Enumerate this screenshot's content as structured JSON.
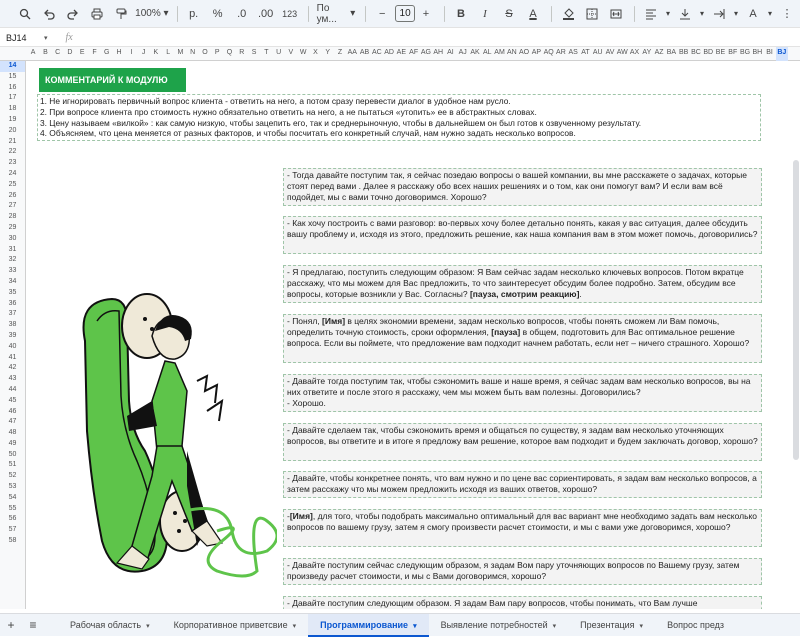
{
  "toolbar": {
    "zoom": "100%",
    "currency": "р.",
    "percent": "%",
    "dec_down": ".0",
    "dec_up": ".00",
    "number_format": "123",
    "font_name": "По ум...",
    "font_size": "10",
    "bold": "B",
    "italic": "I",
    "strike": "S",
    "text_color": "A"
  },
  "formula_bar": {
    "cell_ref": "BJ14",
    "fx": "fx"
  },
  "columns": [
    "A",
    "B",
    "C",
    "D",
    "E",
    "F",
    "G",
    "H",
    "I",
    "J",
    "K",
    "L",
    "M",
    "N",
    "O",
    "P",
    "Q",
    "R",
    "S",
    "T",
    "U",
    "V",
    "W",
    "X",
    "Y",
    "Z",
    "AA",
    "AB",
    "AC",
    "AD",
    "AE",
    "AF",
    "AG",
    "AH",
    "AI",
    "AJ",
    "AK",
    "AL",
    "AM",
    "AN",
    "AO",
    "AP",
    "AQ",
    "AR",
    "AS",
    "AT",
    "AU",
    "AV",
    "AW",
    "AX",
    "AY",
    "AZ",
    "BA",
    "BB",
    "BC",
    "BD",
    "BE",
    "BF",
    "BG",
    "BH",
    "BI",
    "BJ"
  ],
  "rows": [
    "14",
    "15",
    "16",
    "17",
    "18",
    "19",
    "20",
    "21",
    "22",
    "23",
    "24",
    "25",
    "26",
    "27",
    "28",
    "29",
    "30",
    "31",
    "32",
    "33",
    "34",
    "35",
    "36",
    "37",
    "38",
    "39",
    "40",
    "41",
    "42",
    "43",
    "44",
    "45",
    "46",
    "47",
    "48",
    "49",
    "50",
    "51",
    "52",
    "53",
    "54",
    "55",
    "56",
    "57",
    "58"
  ],
  "sheet": {
    "banner": "КОММЕНТАРИЙ К МОДУЛЮ",
    "rules": [
      "1. Не игнорировать первичный вопрос клиента - ответить на него, а потом сразу перевести диалог в удобное нам русло.",
      "2. При вопросе клиента про стоимость нужно обязательно ответить на него, а не пытаться «утопить» ее в абстрактных словах.",
      "3. Цену называем «вилкой» : как самую низкую, чтобы зацепить его, так и среднерыночную, чтобы в дальнейшем он был готов к озвученному результату.",
      "4. Объясняем, что цена меняется от разных факторов, и чтобы посчитать его конкретный случай, нам нужно задать несколько вопросов."
    ],
    "scripts": [
      {
        "a": "- Тогда давайте поступим так, я сейчас позедаю вопросы о вашей компании, вы мне расскажете о задачах, которые стоят перед вами . Далее я расскажу обо всех наших решениях и о том, как они помогут вам? И если вам всё подойдет, мы с вами точно договоримся. Хорошо?"
      },
      {
        "a": "- Как хочу построить с вами разговор: во-первых хочу более детально понять, какая у вас ситуация, далее обсудить вашу проблему и, исходя из этого, предложить решение, как наша компания вам в этом может помочь, договорились?"
      },
      {
        "a": "- Я предлагаю, поступить следующим образом: Я Вам сейчас задам несколько ключевых вопросов. Потом вкратце расскажу, что мы можем для Вас предложить, то что заинтересует обсудим более подробно. Затем, обсудим все вопросы, которые возникли у Вас. Согласны? ",
        "b": "[пауза, смотрим реакцию]",
        "c": "."
      },
      {
        "a": "- Понял, ",
        "b": "[Имя]",
        "c": " в целях экономии времени, задам несколько вопросов, чтобы понять сможем ли Вам помочь, определить точную стоимость, сроки оформления, ",
        "d": "[пауза]",
        "e": " в общем, подготовить для Вас оптимальное решение вопроса. Если вы поймете, что предложение вам подходит начнем работать, если нет – ничего страшного. Хорошо?"
      },
      {
        "a": "-  Давайте тогда поступим так, чтобы сэкономить ваше и наше время, я сейчас задам вам несколько вопросов, вы на них ответите и после этого я расскажу, чем мы можем быть вам полезны. Договорились?\n-  Хорошо."
      },
      {
        "a": "- Давайте сделаем так, чтобы сэкономить время и общаться по существу, я задам вам несколько уточняющих вопросов, вы ответите и в итоге я предложу вам решение, которое вам подходит и будем заключать договор, хорошо?"
      },
      {
        "a": "- Давайте, чтобы конкретнее понять, что вам нужно и по цене вас сориентировать, я задам вам несколько вопросов, а затем расскажу что мы можем предложить исходя из ваших ответов, хорошо?"
      },
      {
        "a": "-",
        "b": "[Имя]",
        "c": ", для того, чтобы подобрать максимально оптимальный для вас вариант мне необходимо задать вам несколько вопросов по вашему грузу, затем я смогу произвести расчет стоимости, и мы с вами уже договоримся, хорошо?"
      },
      {
        "a": "- Давайте поступим сейчас следующим образом, я задам Вом пару уточняющих вопросов по Вашему грузу, затем произведу расчет стоимости, и мы с Вами договоримся, хорошо?"
      },
      {
        "a": "- Давайте поступим следующим образом. Я задам Вам пару вопросов, чтобы понимать, что Вам лучше"
      }
    ]
  },
  "tabs": {
    "add": "+",
    "all": "≡",
    "items": [
      {
        "label": "Рабочая область",
        "dd": "▾"
      },
      {
        "label": "Корпоративное приветсвие",
        "dd": "▾"
      },
      {
        "label": "Программирование",
        "dd": "▾"
      },
      {
        "label": "Выявление потребностей",
        "dd": "▾"
      },
      {
        "label": "Презентация",
        "dd": "▾"
      },
      {
        "label": "Вопрос предз",
        "dd": ""
      }
    ]
  },
  "colors": {
    "accent_green": "#1ea34a",
    "figure_green": "#5ec44a",
    "selection_blue": "#1a73e8"
  }
}
